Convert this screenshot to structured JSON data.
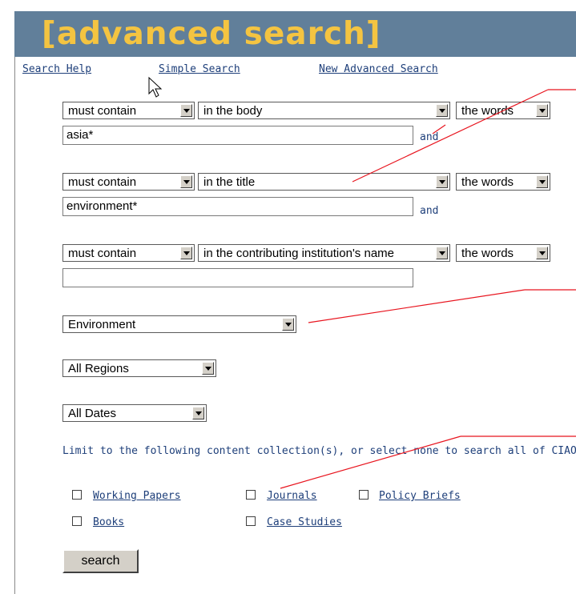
{
  "header": {
    "title": "[advanced search]"
  },
  "links": {
    "help": "Search Help",
    "simple": "Simple Search",
    "new_advanced": "New Advanced Search"
  },
  "rows": [
    {
      "condition": "must contain",
      "field": "in the body",
      "mode": "the words",
      "value": "asia*",
      "connector": "and"
    },
    {
      "condition": "must contain",
      "field": "in the title",
      "mode": "the words",
      "value": "environment*",
      "connector": "and"
    },
    {
      "condition": "must contain",
      "field": "in the contributing institution's name",
      "mode": "the words",
      "value": ""
    }
  ],
  "filters": {
    "topic": "Environment",
    "region": "All Regions",
    "date": "All Dates"
  },
  "limit_text": "Limit to the following content collection(s), or select none to search all of CIAO:",
  "collections": [
    "Working Papers",
    "Journals",
    "Policy Briefs",
    "Books",
    "Case Studies"
  ],
  "search_button": "search",
  "colors": {
    "header_bg": "#617f9a",
    "title": "#f4c441",
    "link": "#1e3f7a",
    "annotation": "#e8141e"
  }
}
